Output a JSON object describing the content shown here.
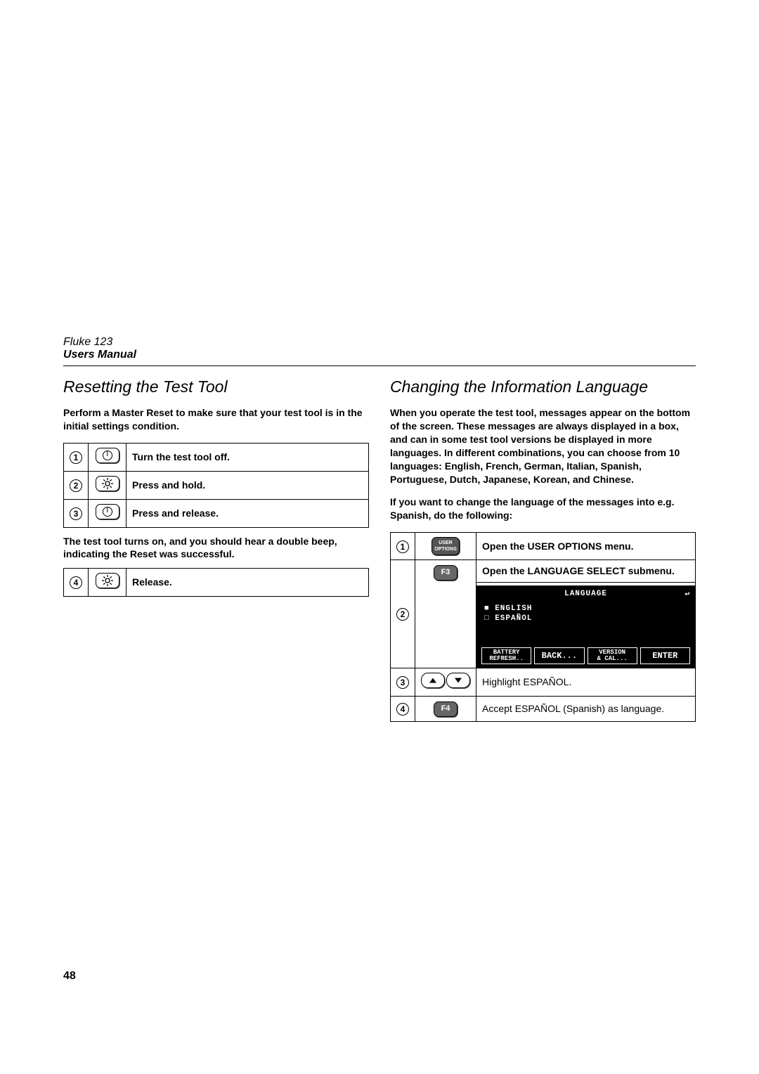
{
  "header": {
    "product": "Fluke 123",
    "subtitle": "Users Manual"
  },
  "left": {
    "title": "Resetting the Test Tool",
    "intro": "Perform a Master Reset to make sure that your test tool is in the initial settings condition.",
    "steps1": [
      {
        "n": "1",
        "desc": "Turn the test tool off."
      },
      {
        "n": "2",
        "desc": "Press and hold."
      },
      {
        "n": "3",
        "desc": "Press and release."
      }
    ],
    "mid": "The test tool turns on, and you should hear a double beep, indicating the Reset was successful.",
    "steps2": [
      {
        "n": "4",
        "desc": "Release."
      }
    ]
  },
  "right": {
    "title": "Changing the Information Language",
    "intro": "When you operate the test tool, messages appear on the bottom of the screen. These messages are always displayed in a box, and can in some test tool versions be displayed in more languages. In different combinations, you can choose from 10 languages: English, French, German, Italian, Spanish, Portuguese, Dutch, Japanese, Korean, and Chinese.",
    "intro2": "If you want to change the language of the messages into e.g. Spanish, do the following:",
    "steps": [
      {
        "n": "1",
        "key": "USER OPTIONS",
        "desc": "Open the USER OPTIONS menu.",
        "bold": true
      },
      {
        "n": "2",
        "key": "F3",
        "desc": "Open the LANGUAGE SELECT submenu.",
        "bold": true
      },
      {
        "n": "3",
        "desc": "Highlight ESPAÑOL.",
        "bold": false
      },
      {
        "n": "4",
        "key": "F4",
        "desc": "Accept ESPAÑOL (Spanish) as language.",
        "bold": false
      }
    ],
    "lcd": {
      "title": "LANGUAGE",
      "opt1": "■ ENGLISH",
      "opt2": "□ ESPAÑOL",
      "f1a": "BATTERY",
      "f1b": "REFRESH..",
      "f2": "BACK...",
      "f3a": "VERSION",
      "f3b": "& CAL...",
      "f4": "ENTER"
    }
  },
  "page_number": "48"
}
